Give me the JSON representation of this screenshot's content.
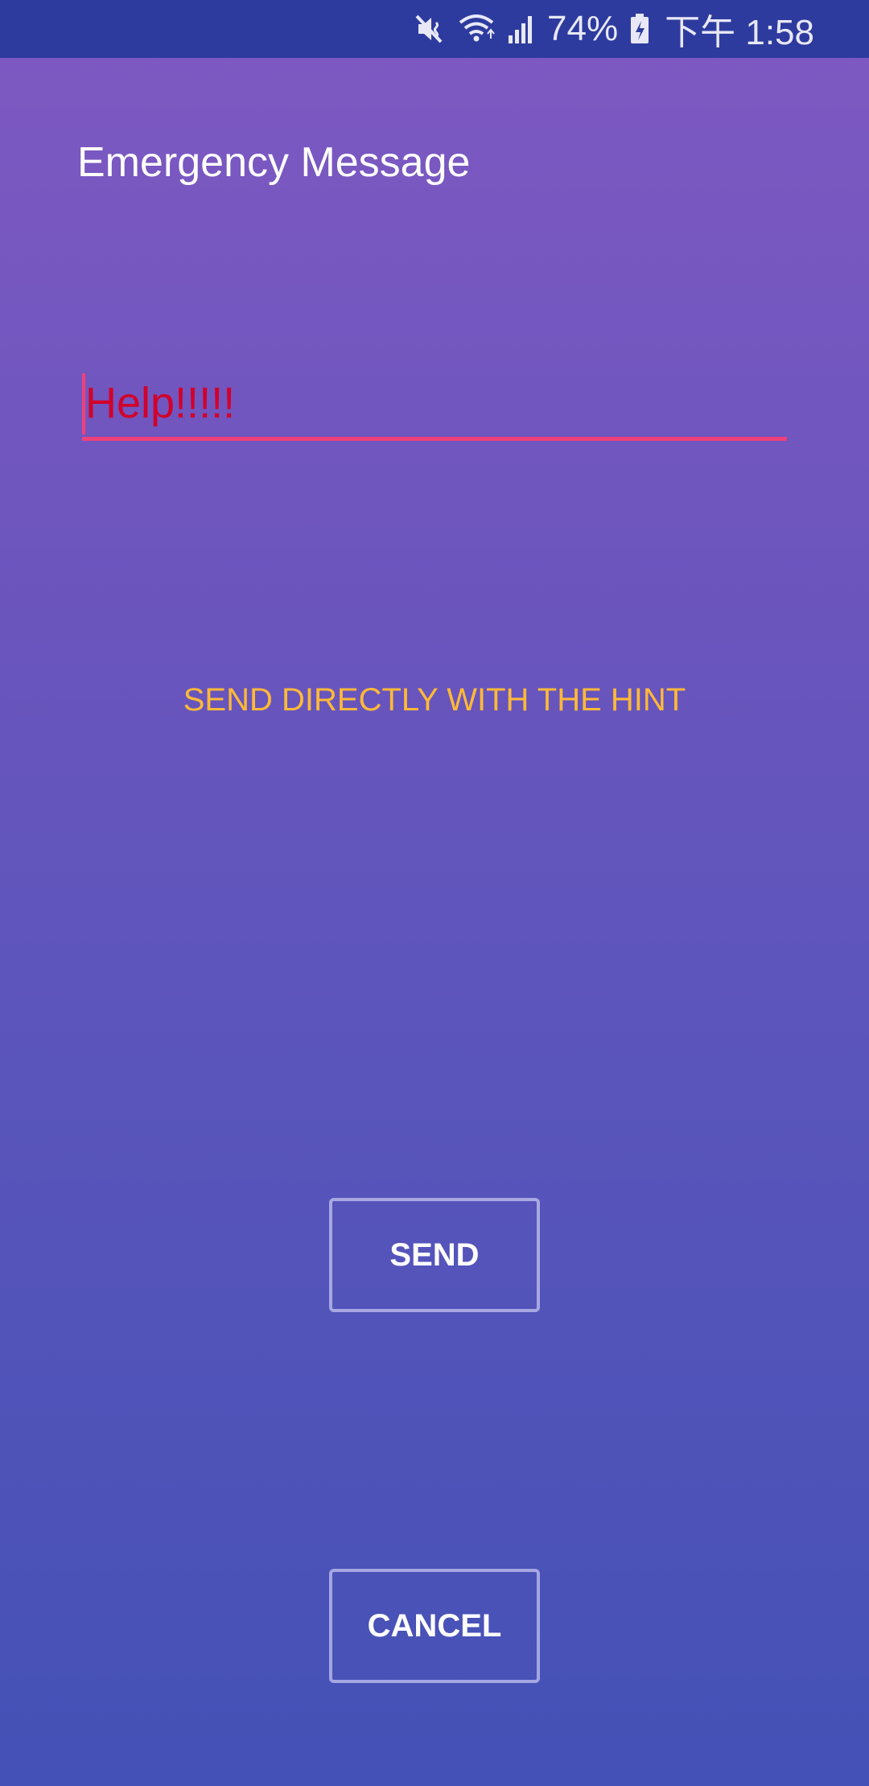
{
  "status_bar": {
    "icons": [
      "mute-vibrate-icon",
      "wifi-icon",
      "signal-icon",
      "battery-charging-icon"
    ],
    "battery_percent": "74%",
    "time": "下午 1:58"
  },
  "screen": {
    "title": "Emergency Message"
  },
  "message": {
    "value": "Help!!!!!"
  },
  "hint_link": {
    "label": "SEND DIRECTLY WITH THE HINT"
  },
  "buttons": {
    "send_label": "SEND",
    "cancel_label": "CANCEL"
  },
  "colors": {
    "status_bar_bg": "#2e3b9e",
    "gradient_top": "#7f59c2",
    "gradient_bottom": "#4451b6",
    "input_accent": "#f0407a",
    "input_text": "#d2002a",
    "hint_text": "#ffb938"
  }
}
